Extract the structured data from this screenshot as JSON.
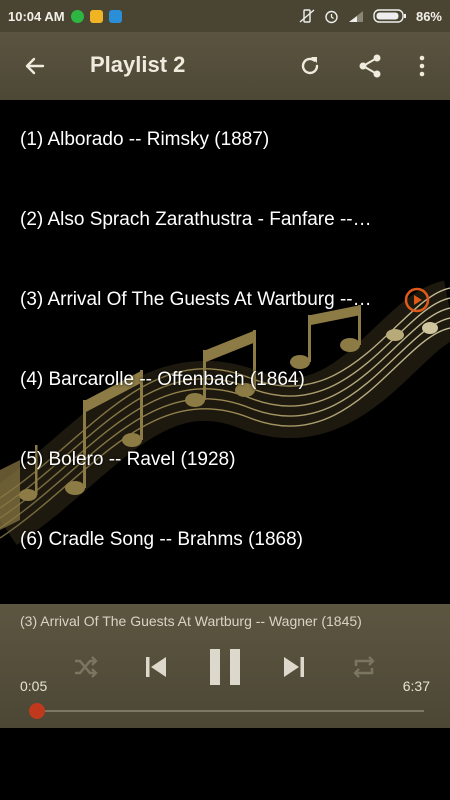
{
  "status_bar": {
    "time": "10:04 AM",
    "battery": "86%",
    "left_icons": [
      "whatsapp-icon",
      "message-icon",
      "app-icon"
    ],
    "right_icons": [
      "vibrate-off-icon",
      "alarm-icon",
      "signal-icon",
      "battery-icon"
    ]
  },
  "app_bar": {
    "title": "Playlist 2",
    "actions": [
      "back-icon",
      "refresh-icon",
      "share-icon",
      "more-icon"
    ]
  },
  "playlist": {
    "tracks": [
      {
        "title": "(1) Alborado -- Rimsky (1887)"
      },
      {
        "title": "(2) Also Sprach Zarathustra - Fanfare --…"
      },
      {
        "title": "(3) Arrival Of The Guests At Wartburg --…",
        "playing": true
      },
      {
        "title": "(4) Barcarolle -- Offenbach (1864)"
      },
      {
        "title": "(5) Bolero -- Ravel  (1928)"
      },
      {
        "title": "(6) Cradle Song -- Brahms (1868)"
      }
    ]
  },
  "player": {
    "now_playing": "(3) Arrival Of The Guests At Wartburg -- Wagner  (1845)",
    "elapsed": "0:05",
    "duration": "6:37",
    "progress_fraction": 0.013,
    "controls": [
      "shuffle-icon",
      "previous-icon",
      "pause-icon",
      "next-icon",
      "repeat-icon"
    ]
  },
  "colors": {
    "bar": "#4d4836",
    "accent": "#e05a1a",
    "seek_knob": "#c0391c"
  }
}
